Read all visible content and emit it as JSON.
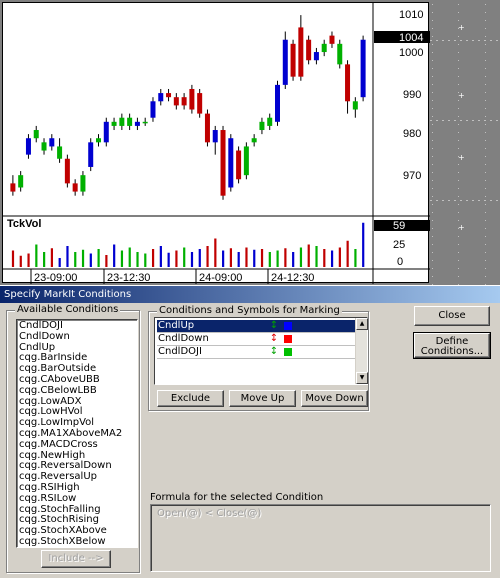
{
  "chart": {
    "volume_label": "TckVol",
    "price_axis_labels": [
      "1010",
      "1000",
      "990",
      "980",
      "970"
    ],
    "current_price": "1004",
    "volume_axis_labels": [
      "25",
      "0"
    ],
    "current_volume": "59",
    "time_labels": [
      "23-09:00",
      "23-12:30",
      "24-09:00",
      "24-12:30"
    ]
  },
  "chart_data": {
    "type": "candlestick",
    "price_ylim": [
      963,
      1011
    ],
    "volume_ylim": [
      0,
      60
    ],
    "candles": [
      {
        "o": 969,
        "c": 967,
        "h": 971,
        "l": 966,
        "color": "red"
      },
      {
        "o": 968,
        "c": 971,
        "h": 972,
        "l": 967,
        "color": "green"
      },
      {
        "o": 976,
        "c": 980,
        "h": 981,
        "l": 975,
        "color": "blue"
      },
      {
        "o": 980,
        "c": 982,
        "h": 983,
        "l": 979,
        "color": "green"
      },
      {
        "o": 979,
        "c": 977,
        "h": 980,
        "l": 976,
        "color": "green"
      },
      {
        "o": 978,
        "c": 980,
        "h": 981,
        "l": 977,
        "color": "blue"
      },
      {
        "o": 978,
        "c": 975,
        "h": 980,
        "l": 974,
        "color": "green"
      },
      {
        "o": 975,
        "c": 969,
        "h": 976,
        "l": 968,
        "color": "red"
      },
      {
        "o": 969,
        "c": 967,
        "h": 970,
        "l": 966,
        "color": "red"
      },
      {
        "o": 967,
        "c": 971,
        "h": 972,
        "l": 966,
        "color": "green"
      },
      {
        "o": 973,
        "c": 979,
        "h": 980,
        "l": 972,
        "color": "blue"
      },
      {
        "o": 979,
        "c": 980,
        "h": 981,
        "l": 978,
        "color": "green"
      },
      {
        "o": 979,
        "c": 984,
        "h": 985,
        "l": 978,
        "color": "blue"
      },
      {
        "o": 984,
        "c": 983,
        "h": 985,
        "l": 982,
        "color": "green"
      },
      {
        "o": 983,
        "c": 985,
        "h": 986,
        "l": 982,
        "color": "green"
      },
      {
        "o": 985,
        "c": 983,
        "h": 986,
        "l": 982,
        "color": "green"
      },
      {
        "o": 983,
        "c": 984,
        "h": 985,
        "l": 982,
        "color": "blue"
      },
      {
        "o": 984,
        "c": 984,
        "h": 985,
        "l": 983,
        "color": "green"
      },
      {
        "o": 985,
        "c": 989,
        "h": 990,
        "l": 984,
        "color": "blue"
      },
      {
        "o": 989,
        "c": 991,
        "h": 992,
        "l": 988,
        "color": "blue"
      },
      {
        "o": 991,
        "c": 990,
        "h": 992,
        "l": 989,
        "color": "red"
      },
      {
        "o": 988,
        "c": 990,
        "h": 991,
        "l": 987,
        "color": "red"
      },
      {
        "o": 990,
        "c": 988,
        "h": 991,
        "l": 987,
        "color": "red"
      },
      {
        "o": 987,
        "c": 992,
        "h": 993,
        "l": 986,
        "color": "red"
      },
      {
        "o": 991,
        "c": 986,
        "h": 992,
        "l": 985,
        "color": "red"
      },
      {
        "o": 986,
        "c": 979,
        "h": 987,
        "l": 978,
        "color": "red"
      },
      {
        "o": 979,
        "c": 982,
        "h": 983,
        "l": 976,
        "color": "blue"
      },
      {
        "o": 982,
        "c": 966,
        "h": 983,
        "l": 965,
        "color": "red"
      },
      {
        "o": 968,
        "c": 980,
        "h": 981,
        "l": 967,
        "color": "blue"
      },
      {
        "o": 977,
        "c": 970,
        "h": 978,
        "l": 969,
        "color": "red"
      },
      {
        "o": 971,
        "c": 978,
        "h": 979,
        "l": 970,
        "color": "green"
      },
      {
        "o": 979,
        "c": 980,
        "h": 981,
        "l": 978,
        "color": "green"
      },
      {
        "o": 982,
        "c": 984,
        "h": 985,
        "l": 981,
        "color": "green"
      },
      {
        "o": 985,
        "c": 983,
        "h": 986,
        "l": 982,
        "color": "green"
      },
      {
        "o": 984,
        "c": 993,
        "h": 994,
        "l": 983,
        "color": "blue"
      },
      {
        "o": 993,
        "c": 1004,
        "h": 1006,
        "l": 992,
        "color": "blue"
      },
      {
        "o": 1003,
        "c": 995,
        "h": 1004,
        "l": 994,
        "color": "red"
      },
      {
        "o": 995,
        "c": 1007,
        "h": 1010,
        "l": 994,
        "color": "red"
      },
      {
        "o": 1004,
        "c": 999,
        "h": 1005,
        "l": 998,
        "color": "red"
      },
      {
        "o": 999,
        "c": 1001,
        "h": 1002,
        "l": 998,
        "color": "blue"
      },
      {
        "o": 1001,
        "c": 1003,
        "h": 1004,
        "l": 1000,
        "color": "green"
      },
      {
        "o": 1003,
        "c": 1005,
        "h": 1006,
        "l": 1002,
        "color": "red"
      },
      {
        "o": 1003,
        "c": 998,
        "h": 1004,
        "l": 997,
        "color": "green"
      },
      {
        "o": 998,
        "c": 989,
        "h": 999,
        "l": 986,
        "color": "red"
      },
      {
        "o": 989,
        "c": 987,
        "h": 990,
        "l": 985,
        "color": "green"
      },
      {
        "o": 990,
        "c": 1004,
        "h": 1005,
        "l": 989,
        "color": "blue"
      }
    ],
    "volume": [
      {
        "v": 22,
        "color": "red"
      },
      {
        "v": 15,
        "color": "red"
      },
      {
        "v": 18,
        "color": "red"
      },
      {
        "v": 30,
        "color": "green"
      },
      {
        "v": 20,
        "color": "green"
      },
      {
        "v": 25,
        "color": "red"
      },
      {
        "v": 12,
        "color": "blue"
      },
      {
        "v": 28,
        "color": "blue"
      },
      {
        "v": 20,
        "color": "green"
      },
      {
        "v": 23,
        "color": "green"
      },
      {
        "v": 18,
        "color": "blue"
      },
      {
        "v": 24,
        "color": "green"
      },
      {
        "v": 16,
        "color": "red"
      },
      {
        "v": 30,
        "color": "blue"
      },
      {
        "v": 22,
        "color": "green"
      },
      {
        "v": 26,
        "color": "green"
      },
      {
        "v": 20,
        "color": "green"
      },
      {
        "v": 18,
        "color": "green"
      },
      {
        "v": 24,
        "color": "red"
      },
      {
        "v": 28,
        "color": "blue"
      },
      {
        "v": 19,
        "color": "blue"
      },
      {
        "v": 22,
        "color": "red"
      },
      {
        "v": 26,
        "color": "green"
      },
      {
        "v": 20,
        "color": "blue"
      },
      {
        "v": 24,
        "color": "blue"
      },
      {
        "v": 28,
        "color": "red"
      },
      {
        "v": 38,
        "color": "red"
      },
      {
        "v": 22,
        "color": "blue"
      },
      {
        "v": 25,
        "color": "red"
      },
      {
        "v": 20,
        "color": "blue"
      },
      {
        "v": 26,
        "color": "red"
      },
      {
        "v": 23,
        "color": "blue"
      },
      {
        "v": 24,
        "color": "red"
      },
      {
        "v": 20,
        "color": "green"
      },
      {
        "v": 22,
        "color": "green"
      },
      {
        "v": 25,
        "color": "red"
      },
      {
        "v": 20,
        "color": "blue"
      },
      {
        "v": 26,
        "color": "green"
      },
      {
        "v": 30,
        "color": "red"
      },
      {
        "v": 28,
        "color": "green"
      },
      {
        "v": 24,
        "color": "red"
      },
      {
        "v": 22,
        "color": "blue"
      },
      {
        "v": 26,
        "color": "red"
      },
      {
        "v": 35,
        "color": "red"
      },
      {
        "v": 24,
        "color": "green"
      },
      {
        "v": 59,
        "color": "blue"
      }
    ]
  },
  "dialog": {
    "title": "Specify MarkIt Conditions",
    "available_label": "Available Conditions",
    "available_items": [
      "CndlDOJI",
      "CndlDown",
      "CndlUp",
      "cqg.BarInside",
      "cqg.BarOutside",
      "cqg.CAboveUBB",
      "cqg.CBelowLBB",
      "cqg.LowADX",
      "cqg.LowHVol",
      "cqg.LowImpVol",
      "cqg.MA1XAboveMA2",
      "cqg.MACDCross",
      "cqg.NewHigh",
      "cqg.ReversalDown",
      "cqg.ReversalUp",
      "cqg.RSIHigh",
      "cqg.RSILow",
      "cqg.StochFalling",
      "cqg.StochRising",
      "cqg.StochXAbove",
      "cqg.StochXBelow"
    ],
    "include_label": "Include -->",
    "marking_label": "Conditions and Symbols for Marking",
    "marking_rows": [
      {
        "name": "CndlUp",
        "symbol": "↕",
        "sym_color": "#00a000",
        "box_color": "#0000ff"
      },
      {
        "name": "CndlDown",
        "symbol": "↕",
        "sym_color": "#e00000",
        "box_color": "#ff0000"
      },
      {
        "name": "CndlDOJI",
        "symbol": "↕",
        "sym_color": "#00a000",
        "box_color": "#00c000"
      }
    ],
    "exclude_label": "Exclude",
    "move_up_label": "Move Up",
    "move_down_label": "Move Down",
    "close_label": "Close",
    "define_label_1": "Define",
    "define_label_2": "Conditions...",
    "formula_label": "Formula for the selected Condition",
    "formula_text": "Open(@) < Close(@)"
  }
}
